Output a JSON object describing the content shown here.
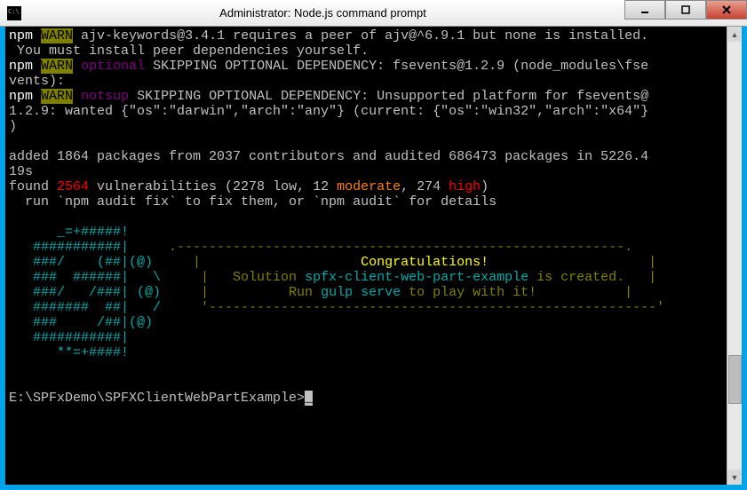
{
  "window": {
    "title": "Administrator: Node.js command prompt"
  },
  "lines": {
    "l1_npm": "npm",
    "l1_warn": "WARN",
    "l1_rest": " ajv-keywords@3.4.1 requires a peer of ajv@^6.9.1 but none is installed.",
    "l2": " You must install peer dependencies yourself.",
    "l3_npm": "npm",
    "l3_warn": "WARN",
    "l3_optional": "optional",
    "l3_rest": " SKIPPING OPTIONAL DEPENDENCY: fsevents@1.2.9 (node_modules\\fse",
    "l4": "vents):",
    "l5_npm": "npm",
    "l5_warn": "WARN",
    "l5_notsup": "notsup",
    "l5_rest": " SKIPPING OPTIONAL DEPENDENCY: Unsupported platform for fsevents@",
    "l6": "1.2.9: wanted {\"os\":\"darwin\",\"arch\":\"any\"} (current: {\"os\":\"win32\",\"arch\":\"x64\"}",
    "l7": ")",
    "l8": "",
    "l9": "added 1864 packages from 2037 contributors and audited 686473 packages in 5226.4",
    "l10": "19s",
    "l11_a": "found ",
    "l11_count": "2564",
    "l11_b": " vulnerabilities (2278 low, 12 ",
    "l11_mod": "moderate",
    "l11_c": ", 274 ",
    "l11_high": "high",
    "l11_d": ")",
    "l12": "  run `npm audit fix` to fix them, or `npm audit` for details",
    "ascii": {
      "a1": "      _=+#####!",
      "a2": "   ###########|",
      "a3": "   ###/    (##|(@)",
      "a4": "   ###  ######|   \\",
      "a5": "   ###/   /###| (@)",
      "a6": "   #######  ##|   /",
      "a7": "   ###     /##|(@)",
      "a8": "   ###########|",
      "a9": "      **=+####!"
    },
    "box": {
      "top": "     .--------------------------------------------------------.",
      "r1_a": "     |                    ",
      "r1_b": "Congratulations!",
      "r1_c": "                    |",
      "r2_a": "     |   Solution ",
      "r2_name": "spfx-client-web-part-example",
      "r2_b": " is created.   |",
      "r3_a": "     |          Run ",
      "r3_cmd": "gulp serve",
      "r3_b": " to play with it!           |",
      "bot": "     '--------------------------------------------------------'"
    },
    "prompt": "E:\\SPFxDemo\\SPFXClientWebPartExample>",
    "cursor": "_"
  }
}
